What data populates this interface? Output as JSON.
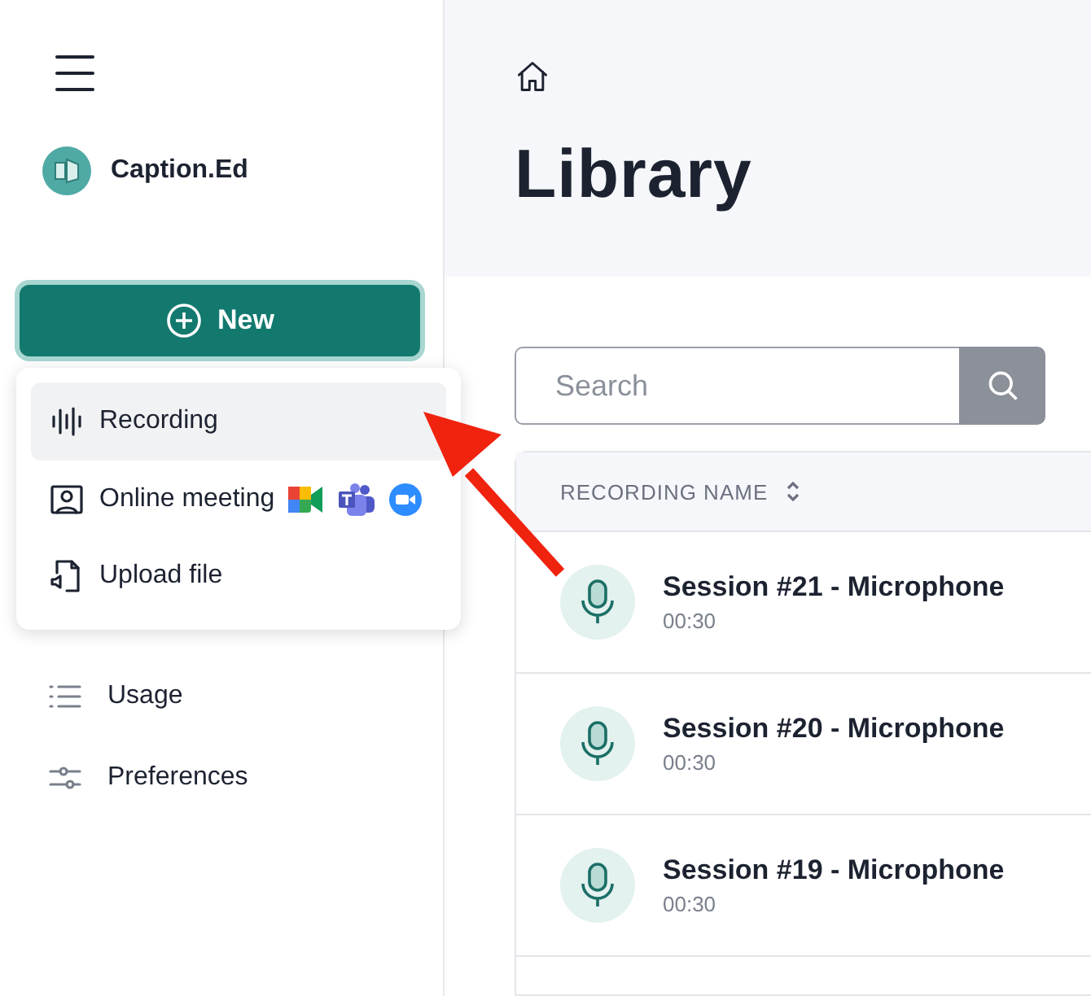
{
  "sidebar": {
    "brand": "Caption.Ed",
    "new_button": "New",
    "nav_items": [
      {
        "kind": "usage",
        "label": "Usage"
      },
      {
        "kind": "preferences",
        "label": "Preferences"
      }
    ]
  },
  "new_menu": {
    "items": [
      {
        "kind": "recording",
        "label": "Recording",
        "selected": true
      },
      {
        "kind": "meeting",
        "label": "Online meeting",
        "selected": false
      },
      {
        "kind": "upload",
        "label": "Upload file",
        "selected": false
      }
    ]
  },
  "main": {
    "title": "Library",
    "search": {
      "placeholder": "Search"
    },
    "table": {
      "columns": [
        "RECORDING NAME"
      ],
      "rows": [
        {
          "name": "Session #21 - Microphone",
          "duration": "00:30"
        },
        {
          "name": "Session #20 - Microphone",
          "duration": "00:30"
        },
        {
          "name": "Session #19 - Microphone",
          "duration": "00:30"
        }
      ]
    }
  }
}
